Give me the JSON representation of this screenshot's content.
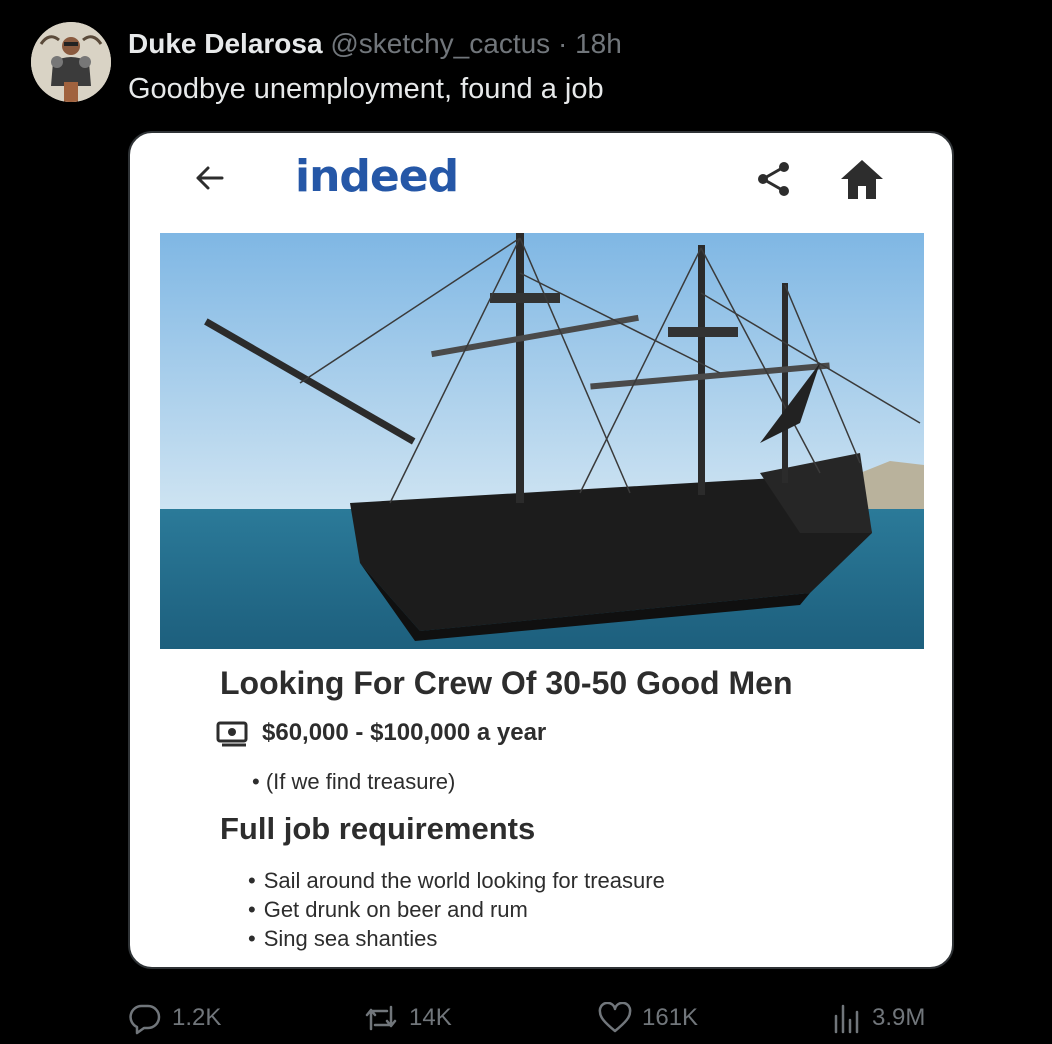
{
  "tweet": {
    "author_name": "Duke Delarosa",
    "handle": "@sketchy_cactus",
    "separator": "·",
    "time": "18h",
    "text": "Goodbye unemployment, found a job"
  },
  "indeed_card": {
    "logo": "indeed",
    "icons": [
      "back-arrow-icon",
      "share-icon",
      "home-icon"
    ],
    "job_title": "Looking For Crew Of 30-50 Good Men",
    "salary": "$60,000 - $100,000 a year",
    "salary_note": "(If we find treasure)",
    "requirements_heading": "Full job requirements",
    "requirements": [
      "Sail around the world looking for treasure",
      "Get drunk on beer and rum",
      "Sing sea shanties"
    ],
    "colors": {
      "brand": "#2557a7",
      "text": "#2d2d2d"
    }
  },
  "actions": {
    "replies": "1.2K",
    "reposts": "14K",
    "likes": "161K",
    "views": "3.9M"
  },
  "colors": {
    "background": "#000000",
    "primary_text": "#e7e9ea",
    "secondary_text": "#71767b"
  }
}
